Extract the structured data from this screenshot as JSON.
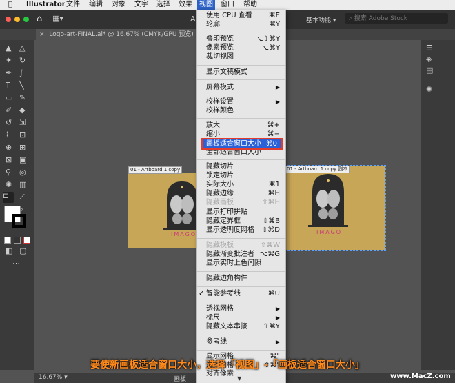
{
  "menubar": {
    "apple": "",
    "items": [
      "Illustrator",
      "文件",
      "编辑",
      "对象",
      "文字",
      "选择",
      "效果",
      "视图",
      "窗口",
      "帮助"
    ],
    "active": "视图"
  },
  "appbar": {
    "workspace": "基本功能",
    "search_placeholder": "搜索 Adobe Stock",
    "center_letter": "A"
  },
  "document": {
    "tab_title": "Logo-art-FINAL.ai* @ 16.67% (CMYK/GPU 预览)",
    "close_glyph": "×"
  },
  "canvas": {
    "artboard1_label": "01 - Artboard 1 copy",
    "artboard2_label": "01 - Artboard 1 copy 副本",
    "logo_text": "IMAGO"
  },
  "status": {
    "zoom": "16.67%",
    "label": "画板"
  },
  "menu": {
    "items": [
      {
        "label": "使用 CPU 查看",
        "shortcut": "⌘E"
      },
      {
        "label": "轮廓",
        "shortcut": "⌘Y"
      },
      {
        "label": "叠印预览",
        "shortcut": "⌥⇧⌘Y"
      },
      {
        "label": "像素预览",
        "shortcut": "⌥⌘Y"
      },
      {
        "label": "裁切视图",
        "shortcut": ""
      },
      {
        "label": "显示文稿模式",
        "shortcut": ""
      },
      {
        "label": "屏幕模式",
        "shortcut": "▶"
      },
      {
        "label": "校样设置",
        "shortcut": "▶"
      },
      {
        "label": "校样颜色",
        "shortcut": ""
      },
      {
        "label": "放大",
        "shortcut": "⌘+"
      },
      {
        "label": "缩小",
        "shortcut": "⌘−"
      },
      {
        "label": "画板适合窗口大小",
        "shortcut": "⌘0"
      },
      {
        "label": "全部适合窗口大小",
        "shortcut": ""
      },
      {
        "label": "隐藏切片",
        "shortcut": ""
      },
      {
        "label": "锁定切片",
        "shortcut": ""
      },
      {
        "label": "实际大小",
        "shortcut": "⌘1"
      },
      {
        "label": "隐藏边缘",
        "shortcut": "⌘H"
      },
      {
        "label": "隐藏画板",
        "shortcut": "⇧⌘H"
      },
      {
        "label": "显示打印拼贴",
        "shortcut": ""
      },
      {
        "label": "隐藏定界框",
        "shortcut": "⇧⌘B"
      },
      {
        "label": "显示透明度网格",
        "shortcut": "⇧⌘D"
      },
      {
        "label": "隐藏模板",
        "shortcut": "⇧⌘W"
      },
      {
        "label": "隐藏渐变批注者",
        "shortcut": "⌥⌘G"
      },
      {
        "label": "显示实时上色间隙",
        "shortcut": ""
      },
      {
        "label": "隐藏边角构件",
        "shortcut": ""
      },
      {
        "label": "智能参考线",
        "shortcut": "⌘U",
        "check": "✓"
      },
      {
        "label": "透视网格",
        "shortcut": "▶"
      },
      {
        "label": "标尺",
        "shortcut": "▶"
      },
      {
        "label": "隐藏文本串接",
        "shortcut": "⇧⌘Y"
      },
      {
        "label": "参考线",
        "shortcut": "▶"
      },
      {
        "label": "显示网格",
        "shortcut": "⌘\""
      },
      {
        "label": "对齐网格",
        "shortcut": "⇧⌘\""
      },
      {
        "label": "对齐像素",
        "shortcut": ""
      }
    ],
    "more_arrow": "▼"
  },
  "caption": "要使新画板适合窗口大小，选择「视图」-「画板适合窗口大小」",
  "watermark": "www.MacZ.com",
  "colors": {
    "highlight": "#2a61d6",
    "callout": "#e23d2c",
    "artboard": "#c8a657",
    "caption": "#ff8a1c"
  }
}
